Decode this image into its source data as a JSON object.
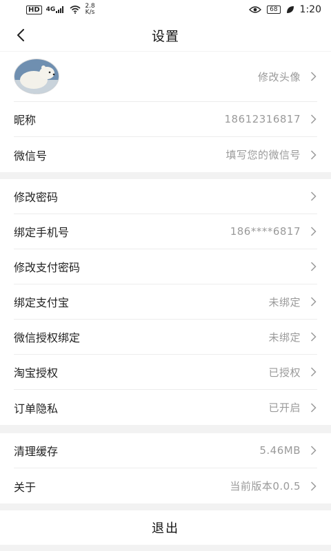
{
  "statusbar": {
    "hd": "HD",
    "network": "4G",
    "speed_value": "2.8",
    "speed_unit": "K/s",
    "battery": "68",
    "time": "1:20"
  },
  "header": {
    "title": "设置"
  },
  "avatar_row": {
    "action": "修改头像"
  },
  "group1": [
    {
      "label": "昵称",
      "value": "18612316817"
    },
    {
      "label": "微信号",
      "value": "填写您的微信号"
    }
  ],
  "group2": [
    {
      "label": "修改密码",
      "value": ""
    },
    {
      "label": "绑定手机号",
      "value": "186****6817"
    },
    {
      "label": "修改支付密码",
      "value": ""
    },
    {
      "label": "绑定支付宝",
      "value": "未绑定"
    },
    {
      "label": "微信授权绑定",
      "value": "未绑定"
    },
    {
      "label": "淘宝授权",
      "value": "已授权"
    },
    {
      "label": "订单隐私",
      "value": "已开启"
    }
  ],
  "group3": [
    {
      "label": "清理缓存",
      "value": "5.46MB"
    },
    {
      "label": "关于",
      "value": "当前版本0.0.5"
    }
  ],
  "logout_label": "退出"
}
